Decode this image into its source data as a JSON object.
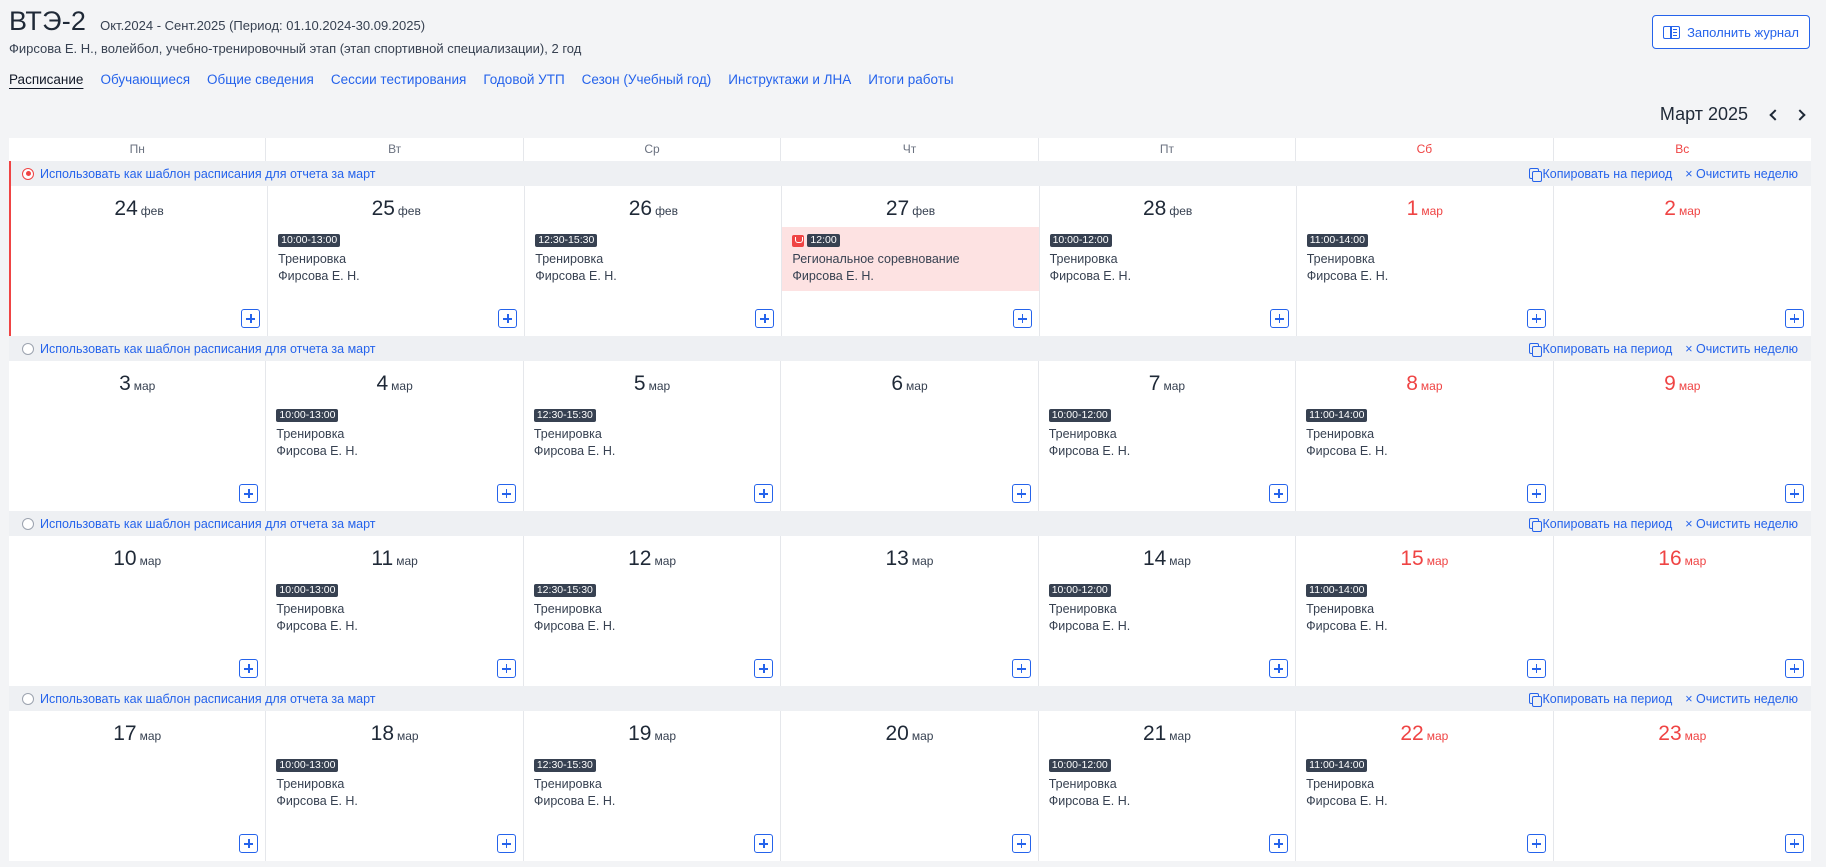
{
  "header": {
    "title": "ВТЭ-2",
    "period": "Окт.2024 - Сент.2025 (Период: 01.10.2024-30.09.2025)",
    "subtitle": "Фирсова Е. Н., волейбол, учебно-тренировочный этап (этап спортивной специализации), 2 год",
    "fill_button": "Заполнить журнал"
  },
  "tabs": [
    {
      "label": "Расписание",
      "active": true
    },
    {
      "label": "Обучающиеся"
    },
    {
      "label": "Общие сведения"
    },
    {
      "label": "Сессии тестирования"
    },
    {
      "label": "Годовой УТП"
    },
    {
      "label": "Сезон (Учебный год)"
    },
    {
      "label": "Инструктажи и ЛНА"
    },
    {
      "label": "Итоги работы"
    }
  ],
  "month": "Март 2025",
  "weekdays": [
    "Пн",
    "Вт",
    "Ср",
    "Чт",
    "Пт",
    "Сб",
    "Вс"
  ],
  "week_bar": {
    "template_label": "Использовать как шаблон расписания для отчета за март",
    "copy_label": "Копировать на период",
    "clear_label": "× Очистить неделю"
  },
  "colors": {
    "accent": "#2563eb",
    "weekend": "#ef4444",
    "competition_bg": "#fde2e2"
  },
  "weeks": [
    {
      "selected": true,
      "days": [
        {
          "num": "24",
          "mon": "фев",
          "events": []
        },
        {
          "num": "25",
          "mon": "фев",
          "events": [
            {
              "time": "10:00-13:00",
              "title": "Тренировка",
              "coach": "Фирсова Е. Н."
            }
          ]
        },
        {
          "num": "26",
          "mon": "фев",
          "events": [
            {
              "time": "12:30-15:30",
              "title": "Тренировка",
              "coach": "Фирсова Е. Н."
            }
          ]
        },
        {
          "num": "27",
          "mon": "фев",
          "events": [
            {
              "time": "12:00",
              "title": "Региональное соревнование",
              "coach": "Фирсова Е. Н.",
              "competition": true
            }
          ]
        },
        {
          "num": "28",
          "mon": "фев",
          "events": [
            {
              "time": "10:00-12:00",
              "title": "Тренировка",
              "coach": "Фирсова Е. Н."
            }
          ]
        },
        {
          "num": "1",
          "mon": "мар",
          "weekend": true,
          "events": [
            {
              "time": "11:00-14:00",
              "title": "Тренировка",
              "coach": "Фирсова Е. Н."
            }
          ]
        },
        {
          "num": "2",
          "mon": "мар",
          "weekend": true,
          "events": []
        }
      ]
    },
    {
      "selected": false,
      "days": [
        {
          "num": "3",
          "mon": "мар",
          "events": []
        },
        {
          "num": "4",
          "mon": "мар",
          "events": [
            {
              "time": "10:00-13:00",
              "title": "Тренировка",
              "coach": "Фирсова Е. Н."
            }
          ]
        },
        {
          "num": "5",
          "mon": "мар",
          "events": [
            {
              "time": "12:30-15:30",
              "title": "Тренировка",
              "coach": "Фирсова Е. Н."
            }
          ]
        },
        {
          "num": "6",
          "mon": "мар",
          "events": []
        },
        {
          "num": "7",
          "mon": "мар",
          "events": [
            {
              "time": "10:00-12:00",
              "title": "Тренировка",
              "coach": "Фирсова Е. Н."
            }
          ]
        },
        {
          "num": "8",
          "mon": "мар",
          "weekend": true,
          "events": [
            {
              "time": "11:00-14:00",
              "title": "Тренировка",
              "coach": "Фирсова Е. Н."
            }
          ]
        },
        {
          "num": "9",
          "mon": "мар",
          "weekend": true,
          "events": []
        }
      ]
    },
    {
      "selected": false,
      "days": [
        {
          "num": "10",
          "mon": "мар",
          "events": []
        },
        {
          "num": "11",
          "mon": "мар",
          "events": [
            {
              "time": "10:00-13:00",
              "title": "Тренировка",
              "coach": "Фирсова Е. Н."
            }
          ]
        },
        {
          "num": "12",
          "mon": "мар",
          "events": [
            {
              "time": "12:30-15:30",
              "title": "Тренировка",
              "coach": "Фирсова Е. Н."
            }
          ]
        },
        {
          "num": "13",
          "mon": "мар",
          "events": []
        },
        {
          "num": "14",
          "mon": "мар",
          "events": [
            {
              "time": "10:00-12:00",
              "title": "Тренировка",
              "coach": "Фирсова Е. Н."
            }
          ]
        },
        {
          "num": "15",
          "mon": "мар",
          "weekend": true,
          "events": [
            {
              "time": "11:00-14:00",
              "title": "Тренировка",
              "coach": "Фирсова Е. Н."
            }
          ]
        },
        {
          "num": "16",
          "mon": "мар",
          "weekend": true,
          "events": []
        }
      ]
    },
    {
      "selected": false,
      "days": [
        {
          "num": "17",
          "mon": "мар",
          "events": []
        },
        {
          "num": "18",
          "mon": "мар",
          "events": [
            {
              "time": "10:00-13:00",
              "title": "Тренировка",
              "coach": "Фирсова Е. Н."
            }
          ]
        },
        {
          "num": "19",
          "mon": "мар",
          "events": [
            {
              "time": "12:30-15:30",
              "title": "Тренировка",
              "coach": "Фирсова Е. Н."
            }
          ]
        },
        {
          "num": "20",
          "mon": "мар",
          "events": []
        },
        {
          "num": "21",
          "mon": "мар",
          "events": [
            {
              "time": "10:00-12:00",
              "title": "Тренировка",
              "coach": "Фирсова Е. Н."
            }
          ]
        },
        {
          "num": "22",
          "mon": "мар",
          "weekend": true,
          "events": [
            {
              "time": "11:00-14:00",
              "title": "Тренировка",
              "coach": "Фирсова Е. Н."
            }
          ]
        },
        {
          "num": "23",
          "mon": "мар",
          "weekend": true,
          "events": []
        }
      ]
    }
  ]
}
